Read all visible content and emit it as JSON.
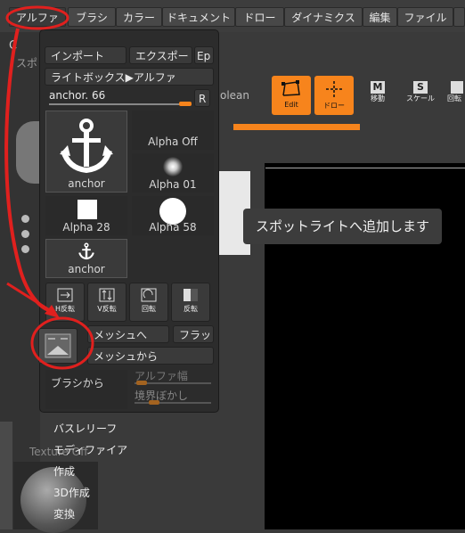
{
  "menubar": {
    "items": [
      "アルファ",
      "ブラシ",
      "カラー",
      "ドキュメント",
      "ドロー",
      "ダイナミクス",
      "編集",
      "ファイル"
    ]
  },
  "toolbar": {
    "edit_label": "Edit",
    "draw_label": "ドロー",
    "move_label": "移動",
    "move_letter": "M",
    "scale_label": "スケール",
    "scale_letter": "S",
    "rotate_label": "回転",
    "boolean_label": "olean"
  },
  "popup": {
    "import_label": "インポート",
    "export_label": "エクスポート",
    "ep_label": "Ep",
    "lightbox_label": "ライトボックス▶アルファ",
    "slider_label": "anchor. 66",
    "r_label": "R",
    "thumbs": [
      {
        "caption": "anchor"
      },
      {
        "caption": "Alpha Off"
      },
      {
        "caption": "Alpha 01"
      },
      {
        "caption": "Alpha 28"
      },
      {
        "caption": "Alpha 58"
      },
      {
        "caption": "anchor"
      }
    ],
    "tools": [
      {
        "label": "H反転"
      },
      {
        "label": "V反転"
      },
      {
        "label": "回転"
      },
      {
        "label": "反転"
      }
    ],
    "to_mesh_label": "メッシュへ",
    "flat_label": "フラット",
    "from_mesh_label": "メッシュから",
    "from_brush_label": "ブラシから",
    "alpha_width_label": "アルファ幅",
    "blur_label": "境界ぼかし"
  },
  "side_menu": {
    "items": [
      "バスレリーフ",
      "モディファイア",
      "作成",
      "3D作成",
      "変換"
    ],
    "texture_label": "Texture Off"
  },
  "left_panel": {
    "ghost_letter": "C",
    "ghost_text": "スポ"
  },
  "tooltip": {
    "text": "スポットライトへ追加します"
  },
  "colors": {
    "accent": "#f7841c",
    "annotation": "#e0201e"
  }
}
